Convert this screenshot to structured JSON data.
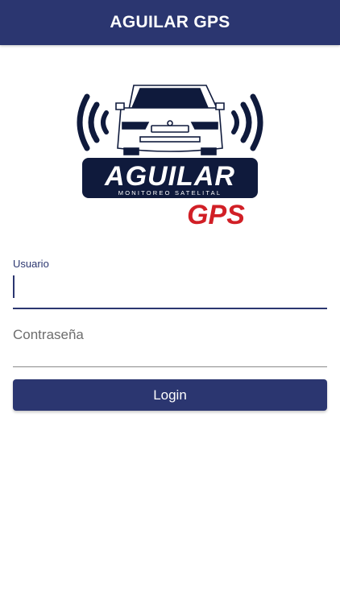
{
  "appbar": {
    "title": "AGUILAR GPS"
  },
  "logo": {
    "brand": "AGUILAR",
    "tagline": "MONITOREO SATELITAL",
    "product": "GPS",
    "colors": {
      "navy": "#0f1a3c",
      "red": "#d11f26"
    }
  },
  "form": {
    "username": {
      "label": "Usuario",
      "value": ""
    },
    "password": {
      "placeholder": "Contraseña",
      "value": ""
    },
    "login_label": "Login"
  },
  "colors": {
    "primary": "#2b3670",
    "background": "#ffffff"
  }
}
